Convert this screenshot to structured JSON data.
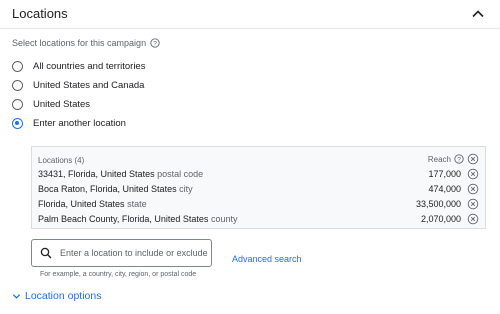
{
  "header": {
    "title": "Locations"
  },
  "subtitle": "Select locations for this campaign",
  "options": [
    {
      "label": "All countries and territories",
      "selected": false
    },
    {
      "label": "United States and Canada",
      "selected": false
    },
    {
      "label": "United States",
      "selected": false
    },
    {
      "label": "Enter another location",
      "selected": true
    }
  ],
  "locations": {
    "header": "Locations (4)",
    "reach_label": "Reach",
    "items": [
      {
        "name": "33431, Florida, United States",
        "type": "postal code",
        "reach": "177,000"
      },
      {
        "name": "Boca Raton, Florida, United States",
        "type": "city",
        "reach": "474,000"
      },
      {
        "name": "Florida, United States",
        "type": "state",
        "reach": "33,500,000"
      },
      {
        "name": "Palm Beach County, Florida, United States",
        "type": "county",
        "reach": "2,070,000"
      }
    ]
  },
  "search": {
    "placeholder": "Enter a location to include or exclude",
    "value": "",
    "helper": "For example, a country, city, region, or postal code"
  },
  "advanced_search_label": "Advanced search",
  "location_options_label": "Location options",
  "colors": {
    "accent": "#1a73e8",
    "text": "#202124",
    "muted": "#5f6368"
  }
}
